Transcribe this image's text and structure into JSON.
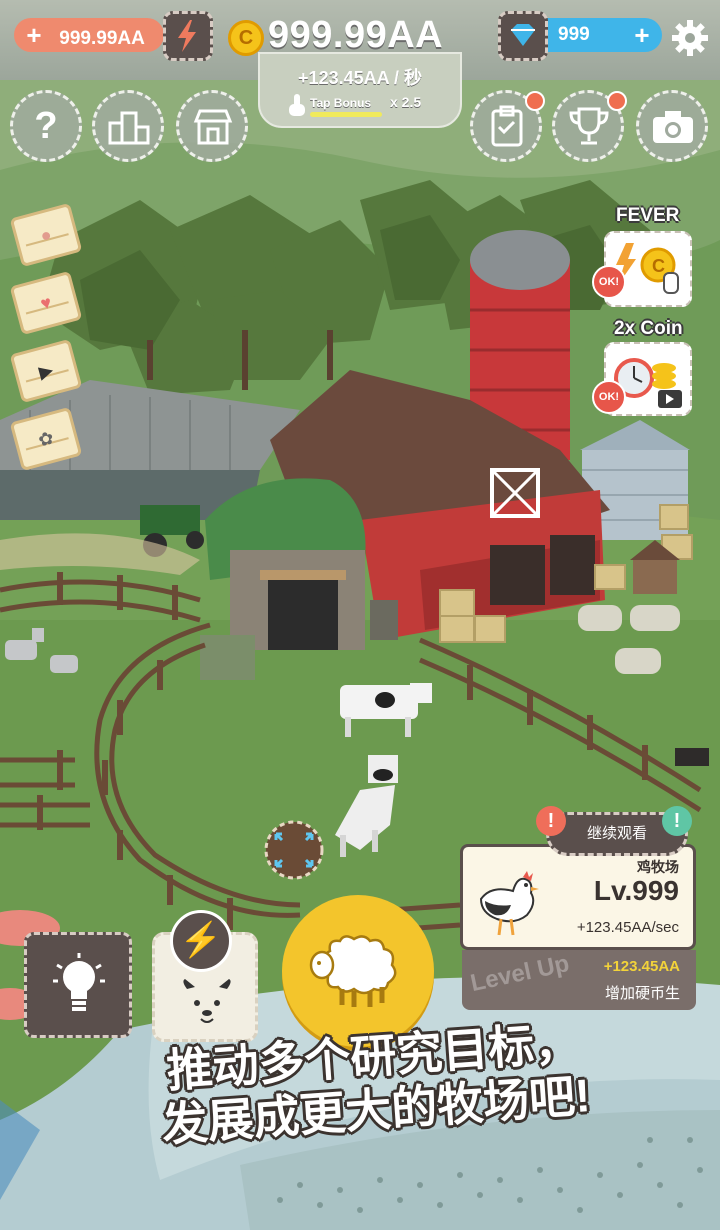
{
  "hud": {
    "energy_value": "999.99AA",
    "coins_value": "999.99AA",
    "gems_value": "999",
    "income_rate": "+123.45AA / 秒",
    "tap_bonus_label": "Tap Bonus",
    "tap_multiplier": "x 2.5",
    "coin_symbol": "C"
  },
  "bonuses": {
    "fever_title": "FEVER",
    "double_coin_title": "2x Coin",
    "ok_label": "OK!"
  },
  "ranch": {
    "continue_label": "继续观看",
    "name": "鸡牧场",
    "level": "Lv.999",
    "rate": "+123.45AA/sec",
    "levelup_watermark": "Level Up",
    "levelup_value": "+123.45AA",
    "levelup_desc": "增加硬币生"
  },
  "banner": {
    "line1": "推动多个研究目标，",
    "line2": "发展成更大的牧场吧!"
  },
  "icons": {
    "help": "question-icon",
    "ranking": "podium-icon",
    "shop": "shop-icon",
    "tasks": "clipboard-icon",
    "trophy": "trophy-icon",
    "camera": "camera-icon",
    "settings": "gear-icon"
  },
  "colors": {
    "energy_pill": "#ef8a6e",
    "gem_pill": "#3fb5e9",
    "coin": "#f5c31a",
    "sheep_button": "#f3c52c",
    "dark_panel": "#5a4f4c"
  }
}
